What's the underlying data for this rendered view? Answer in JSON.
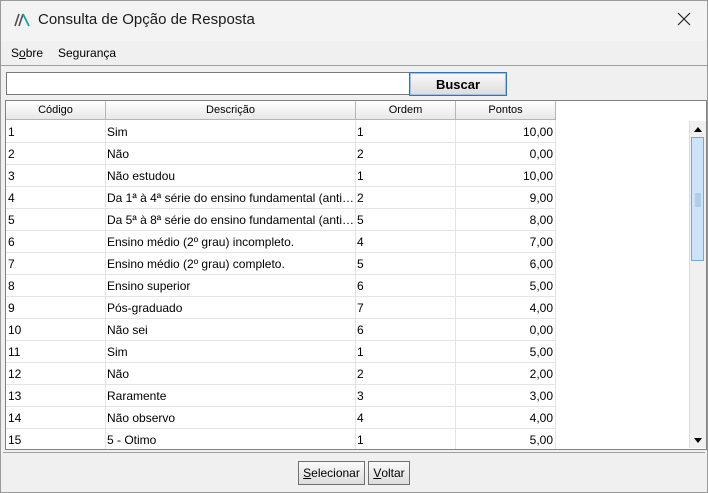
{
  "window": {
    "title": "Consulta de Opção de Resposta",
    "icon": "app-logo-icon",
    "close_icon": "close-icon"
  },
  "menu": {
    "items": [
      {
        "label": "Sobre",
        "accesskey": "o"
      },
      {
        "label": "Segurança"
      }
    ]
  },
  "search": {
    "value": "",
    "button_label": "Buscar"
  },
  "table": {
    "columns": [
      "Código",
      "Descrição",
      "Ordem",
      "Pontos"
    ],
    "rows": [
      {
        "codigo": "1",
        "descricao": "Sim",
        "ordem": "1",
        "pontos": "10,00"
      },
      {
        "codigo": "2",
        "descricao": "Não",
        "ordem": "2",
        "pontos": "0,00"
      },
      {
        "codigo": "3",
        "descricao": "Não estudou",
        "ordem": "1",
        "pontos": "10,00"
      },
      {
        "codigo": "4",
        "descricao": "Da 1ª à 4ª série do ensino fundamental (antig...",
        "ordem": "2",
        "pontos": "9,00"
      },
      {
        "codigo": "5",
        "descricao": "Da 5ª à 8ª série do ensino fundamental (antig...",
        "ordem": "5",
        "pontos": "8,00"
      },
      {
        "codigo": "6",
        "descricao": "Ensino médio (2º grau) incompleto.",
        "ordem": "4",
        "pontos": "7,00"
      },
      {
        "codigo": "7",
        "descricao": "Ensino médio (2º grau) completo.",
        "ordem": "5",
        "pontos": "6,00"
      },
      {
        "codigo": "8",
        "descricao": "Ensino superior",
        "ordem": "6",
        "pontos": "5,00"
      },
      {
        "codigo": "9",
        "descricao": "Pós-graduado",
        "ordem": "7",
        "pontos": "4,00"
      },
      {
        "codigo": "10",
        "descricao": "Não sei",
        "ordem": "6",
        "pontos": "0,00"
      },
      {
        "codigo": "11",
        "descricao": "Sim",
        "ordem": "1",
        "pontos": "5,00"
      },
      {
        "codigo": "12",
        "descricao": "Não",
        "ordem": "2",
        "pontos": "2,00"
      },
      {
        "codigo": "13",
        "descricao": "Raramente",
        "ordem": "3",
        "pontos": "3,00"
      },
      {
        "codigo": "14",
        "descricao": "Não observo",
        "ordem": "4",
        "pontos": "4,00"
      },
      {
        "codigo": "15",
        "descricao": "5 - Otimo",
        "ordem": "1",
        "pontos": "5,00"
      }
    ]
  },
  "footer": {
    "select_label": "Selecionar",
    "back_label": "Voltar"
  },
  "colors": {
    "accent": "#3b6fb6",
    "logo_teal": "#1aa39a",
    "scroll_thumb": "#cde3f7"
  }
}
